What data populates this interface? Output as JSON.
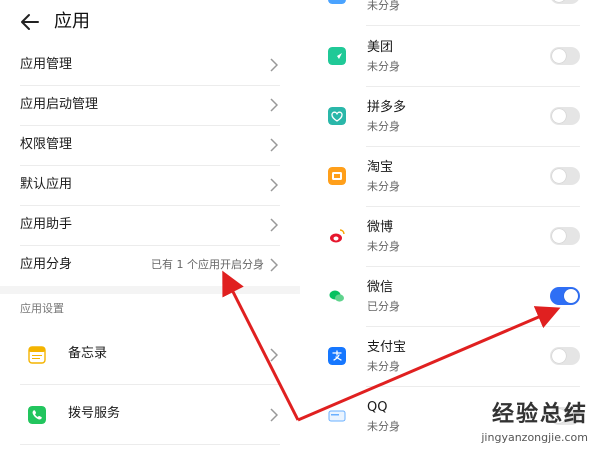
{
  "header": {
    "title": "应用"
  },
  "left_menu": [
    {
      "label": "应用管理"
    },
    {
      "label": "应用启动管理"
    },
    {
      "label": "权限管理"
    },
    {
      "label": "默认应用"
    },
    {
      "label": "应用助手"
    },
    {
      "label": "应用分身",
      "extra": "已有 1 个应用开启分身"
    }
  ],
  "settings_section": {
    "title": "应用设置",
    "items": [
      {
        "label": "备忘录",
        "icon": "memo-icon",
        "color": "#f4b400"
      },
      {
        "label": "拨号服务",
        "icon": "phone-icon",
        "color": "#22c55e"
      }
    ]
  },
  "app_list": [
    {
      "name": "",
      "status": "未分身",
      "enabled": false,
      "icon": "app-icon",
      "color": "#4aa3ff"
    },
    {
      "name": "美团",
      "status": "未分身",
      "enabled": false,
      "icon": "meituan-icon",
      "color": "#20c997"
    },
    {
      "name": "拼多多",
      "status": "未分身",
      "enabled": false,
      "icon": "pinduoduo-icon",
      "color": "#2ab7a9"
    },
    {
      "name": "淘宝",
      "status": "未分身",
      "enabled": false,
      "icon": "taobao-icon",
      "color": "#ff9f1a"
    },
    {
      "name": "微博",
      "status": "未分身",
      "enabled": false,
      "icon": "weibo-icon",
      "color": "#e6162d"
    },
    {
      "name": "微信",
      "status": "已分身",
      "enabled": true,
      "icon": "wechat-icon",
      "color": "#07c160"
    },
    {
      "name": "支付宝",
      "status": "未分身",
      "enabled": false,
      "icon": "alipay-icon",
      "color": "#1677ff"
    },
    {
      "name": "QQ",
      "status": "未分身",
      "enabled": false,
      "icon": "qq-icon",
      "color": "#6ab0ff"
    }
  ],
  "colors": {
    "accent": "#2f6ff5",
    "arrow": "#e02020"
  },
  "watermark": {
    "text": "经验总结",
    "url": "jingyanzongjie.com"
  }
}
